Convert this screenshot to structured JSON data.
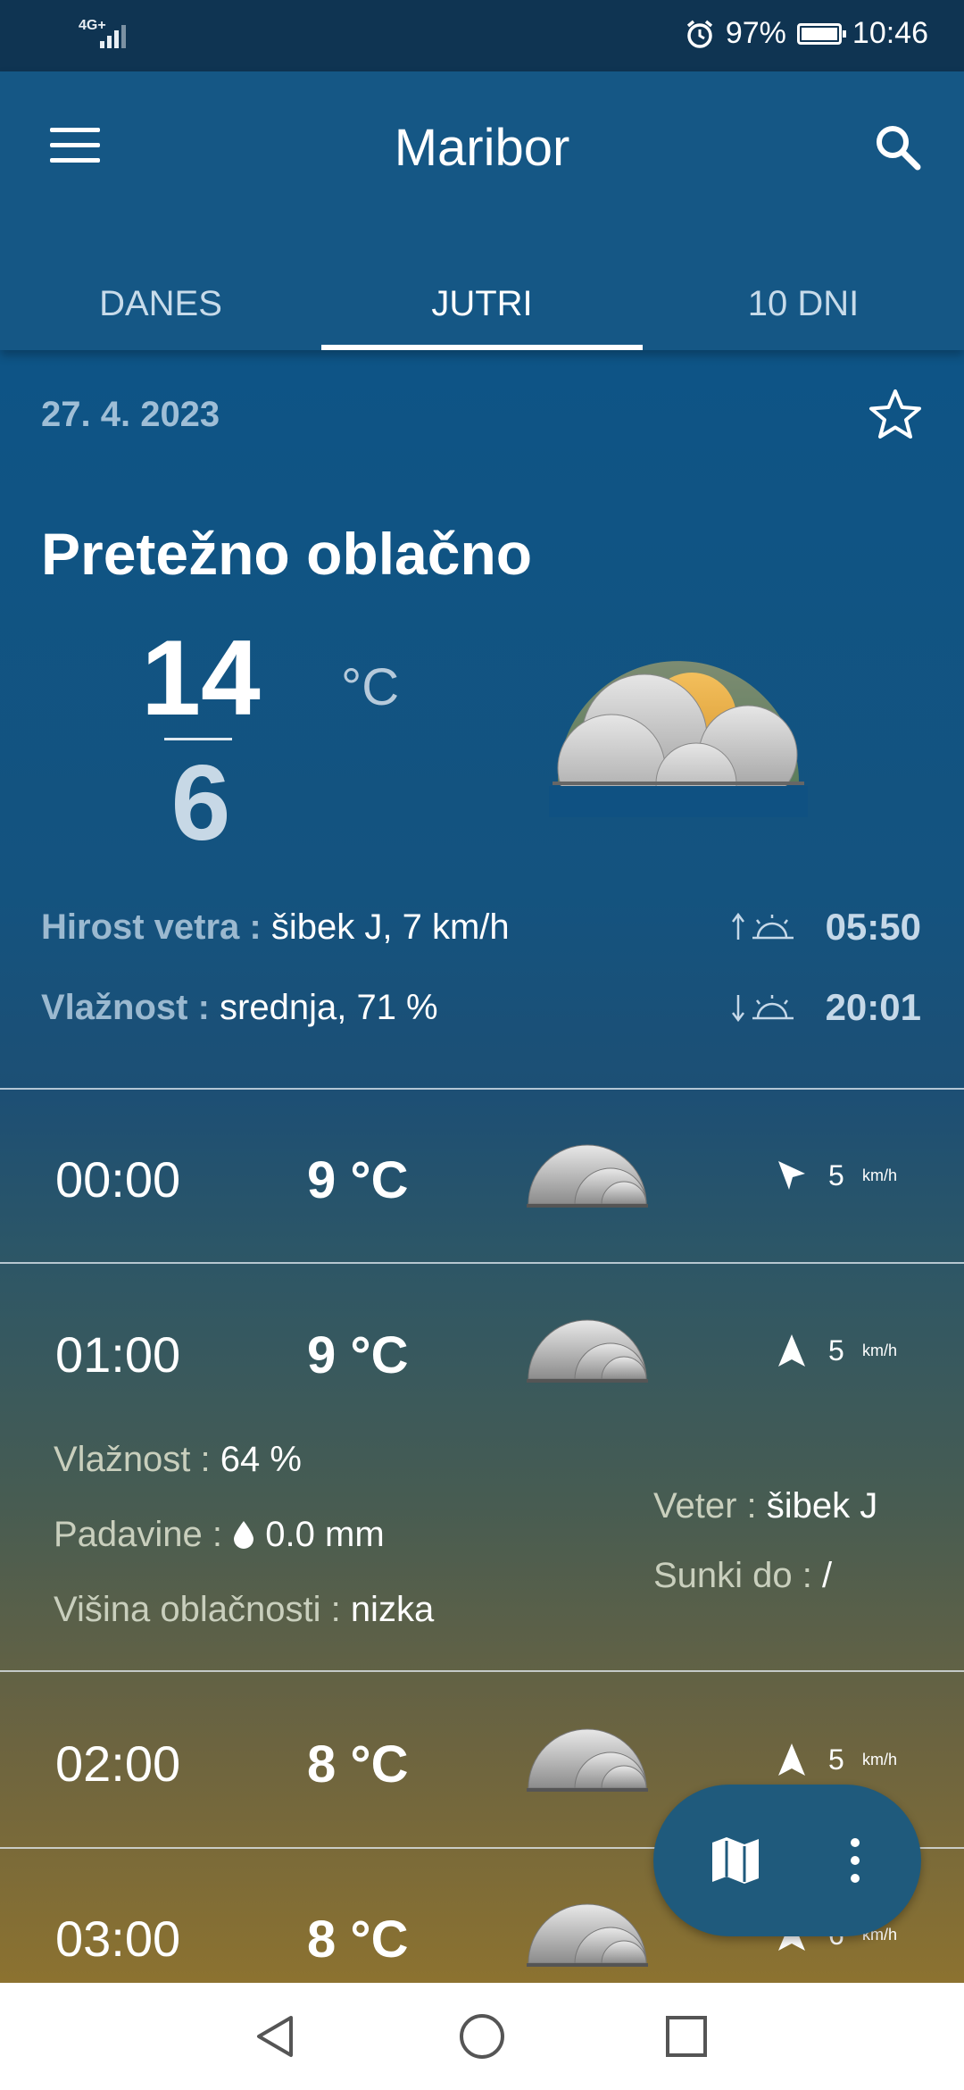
{
  "status": {
    "network": "4G+",
    "battery": "97%",
    "time": "10:46"
  },
  "header": {
    "title": "Maribor"
  },
  "tabs": [
    {
      "label": "DANES"
    },
    {
      "label": "JUTRI"
    },
    {
      "label": "10 DNI"
    }
  ],
  "active_tab": "JUTRI",
  "summary": {
    "date": "27. 4. 2023",
    "condition": "Pretežno oblačno",
    "temp_max": "14",
    "temp_min": "6",
    "unit": "°C",
    "wind_label": "Hirost vetra :",
    "wind_value": "šibek J, 7 km/h",
    "humidity_label": "Vlažnost :",
    "humidity_value": "srednja, 71 %",
    "sunrise": "05:50",
    "sunset": "20:01"
  },
  "hourly": [
    {
      "time": "00:00",
      "temp": "9 °C",
      "wind_speed": "5",
      "wind_unit": "km/h"
    },
    {
      "time": "01:00",
      "temp": "9 °C",
      "wind_speed": "5",
      "wind_unit": "km/h"
    },
    {
      "time": "02:00",
      "temp": "8 °C",
      "wind_speed": "5",
      "wind_unit": "km/h"
    },
    {
      "time": "03:00",
      "temp": "8 °C",
      "wind_speed": "6",
      "wind_unit": "km/h"
    }
  ],
  "details": {
    "humidity_label": "Vlažnost :",
    "humidity_value": "64 %",
    "precip_label": "Padavine :",
    "precip_value": "0.0 mm",
    "cloud_label": "Višina oblačnosti :",
    "cloud_value": "nizka",
    "wind_label": "Veter :",
    "wind_value": "šibek J",
    "gust_label": "Sunki do :",
    "gust_value": "/"
  },
  "icons": {
    "menu": "menu-icon",
    "search": "search-icon",
    "favorite": "star-icon",
    "weather": "partly-cloudy-icon",
    "hourly_weather": "cloud-icon",
    "map": "map-icon",
    "more": "more-vert-icon"
  },
  "colors": {
    "header": "#155785",
    "accent_text": "#9fbed6",
    "fab": "#1f5a7c"
  }
}
